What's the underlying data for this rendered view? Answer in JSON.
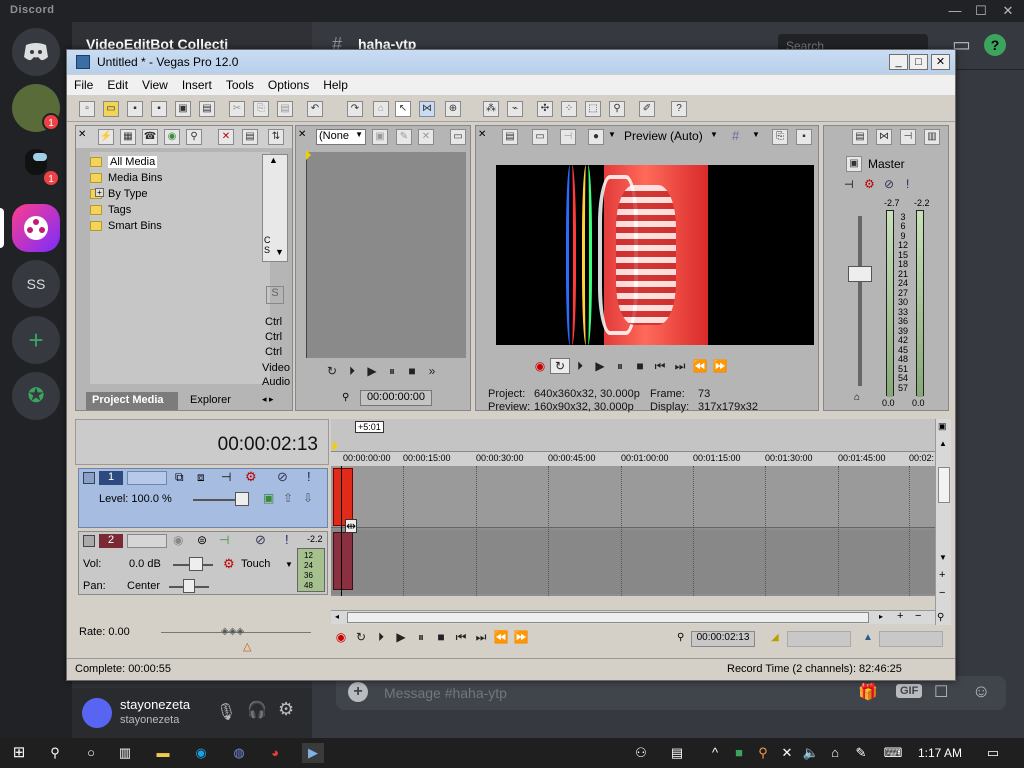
{
  "discord": {
    "brand": "Discord",
    "server_label": "SS",
    "badges": [
      "1",
      "1"
    ],
    "channel_name": "VideoEditBot Collecti",
    "chat_channel": "haha-ytp",
    "search_placeholder": "Search",
    "message_placeholder": "Message #haha-ytp",
    "gif_label": "GIF",
    "user": {
      "name": "stayonezeta",
      "tag": "stayonezeta"
    }
  },
  "taskbar": {
    "time": "1:17 AM"
  },
  "vegas": {
    "title": "Untitled * - Vegas Pro 12.0",
    "menu": [
      "File",
      "Edit",
      "View",
      "Insert",
      "Tools",
      "Options",
      "Help"
    ],
    "project_media": {
      "tree": [
        "All Media",
        "Media Bins",
        "By Type",
        "Tags",
        "Smart Bins"
      ],
      "tabs": [
        "Project Media",
        "Explorer"
      ],
      "side_labels": [
        "Ctrl",
        "Ctrl",
        "Ctrl",
        "Video",
        "Audio"
      ],
      "scroll_letters": [
        "C",
        "S"
      ]
    },
    "trimmer": {
      "dropdown": "(None",
      "timecode": "00:00:00:00"
    },
    "preview": {
      "mode": "Preview (Auto)",
      "project_label": "Project:",
      "project_value": "640x360x32, 30.000p",
      "preview_label": "Preview:",
      "preview_value": "160x90x32, 30.000p",
      "frame_label": "Frame:",
      "frame_value": "73",
      "display_label": "Display:",
      "display_value": "317x179x32"
    },
    "master": {
      "label": "Master",
      "peak_left": "-2.7",
      "peak_right": "-2.2",
      "scale": [
        "3",
        "6",
        "9",
        "12",
        "15",
        "18",
        "21",
        "24",
        "27",
        "30",
        "33",
        "36",
        "39",
        "42",
        "45",
        "48",
        "51",
        "54",
        "57"
      ],
      "bottom_left": "0.0",
      "bottom_right": "0.0"
    },
    "timeline": {
      "timecode": "00:00:02:13",
      "offset_badge": "+5:01",
      "ruler": [
        "00:00:00:00",
        "00:00:15:00",
        "00:00:30:00",
        "00:00:45:00",
        "00:01:00:00",
        "00:01:15:00",
        "00:01:30:00",
        "00:01:45:00",
        "00:02:"
      ],
      "video_track": {
        "number": "1",
        "level": "Level: 100.0 %"
      },
      "audio_track": {
        "number": "2",
        "vol_label": "Vol:",
        "vol_value": "0.0 dB",
        "pan_label": "Pan:",
        "pan_value": "Center",
        "automation": "Touch",
        "meter_peak": "-2.2",
        "meter_scale": [
          "12",
          "24",
          "36",
          "48"
        ]
      },
      "rate": "Rate: 0.00",
      "cursor_time": "00:00:02:13"
    },
    "status": {
      "left": "Complete: 00:00:55",
      "right": "Record Time (2 channels): 82:46:25"
    }
  }
}
